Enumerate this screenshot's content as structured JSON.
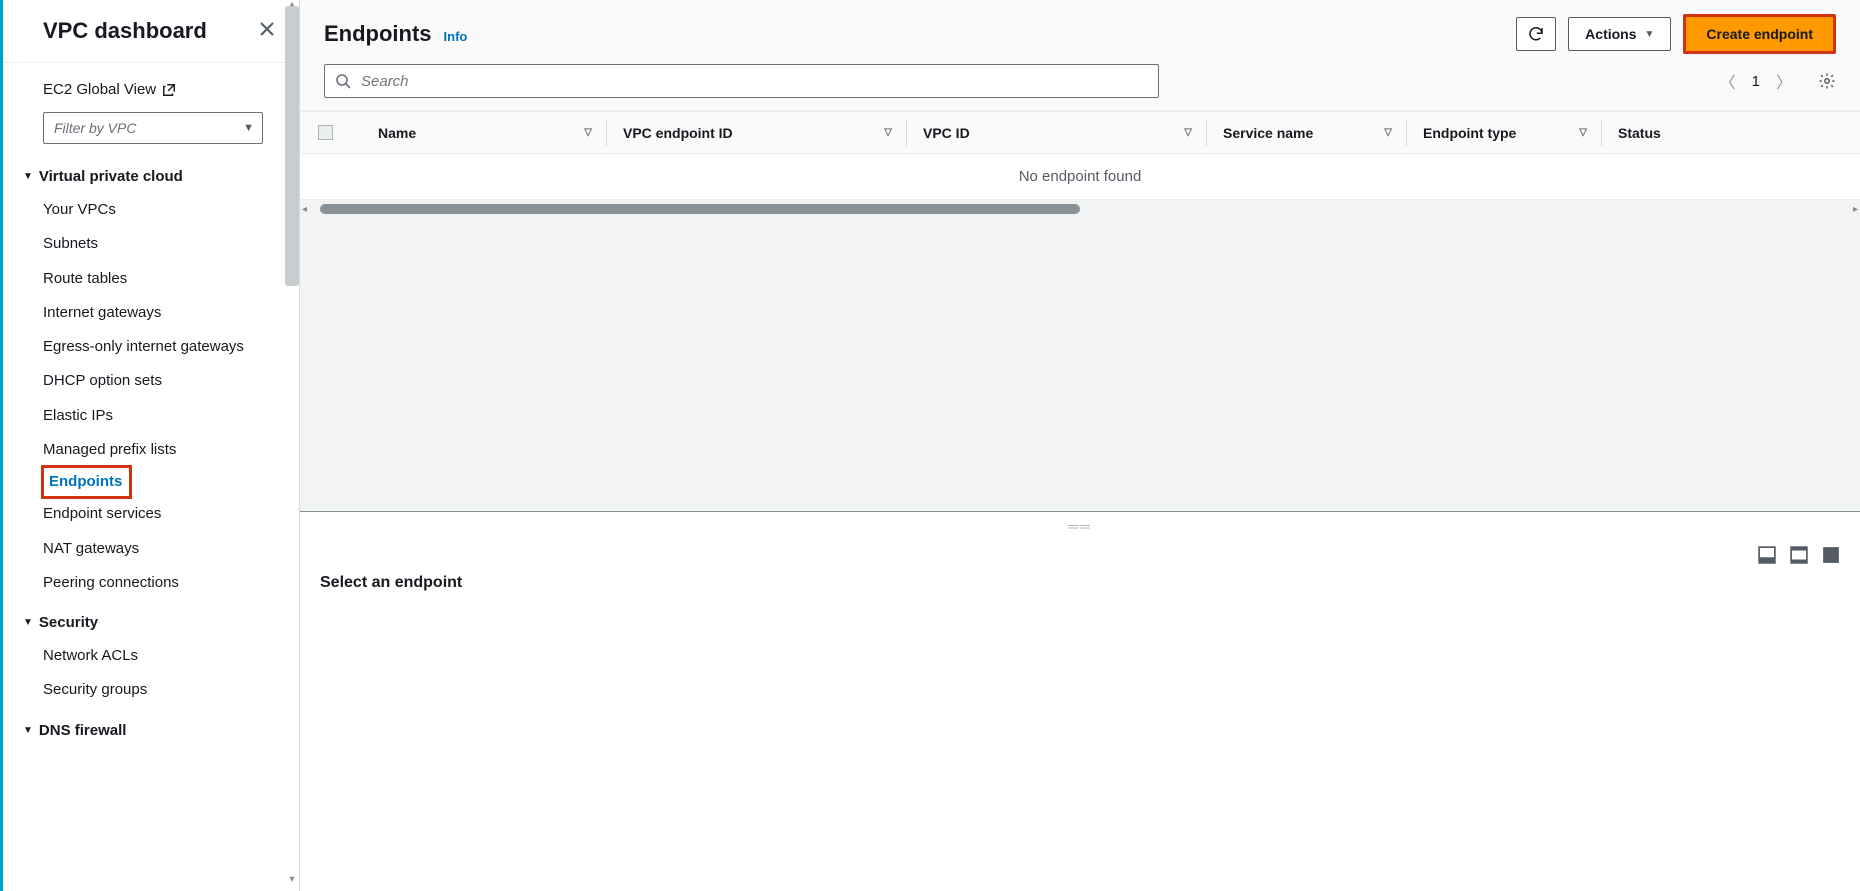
{
  "sidebar": {
    "title": "VPC dashboard",
    "ec2_link": "EC2 Global View",
    "filter_placeholder": "Filter by VPC",
    "groups": [
      {
        "label": "Virtual private cloud",
        "items": [
          {
            "label": "Your VPCs"
          },
          {
            "label": "Subnets"
          },
          {
            "label": "Route tables"
          },
          {
            "label": "Internet gateways"
          },
          {
            "label": "Egress-only internet gateways"
          },
          {
            "label": "DHCP option sets"
          },
          {
            "label": "Elastic IPs"
          },
          {
            "label": "Managed prefix lists"
          },
          {
            "label": "Endpoints",
            "active": true
          },
          {
            "label": "Endpoint services"
          },
          {
            "label": "NAT gateways"
          },
          {
            "label": "Peering connections"
          }
        ]
      },
      {
        "label": "Security",
        "items": [
          {
            "label": "Network ACLs"
          },
          {
            "label": "Security groups"
          }
        ]
      },
      {
        "label": "DNS firewall",
        "items": []
      }
    ]
  },
  "header": {
    "title": "Endpoints",
    "info": "Info",
    "actions_label": "Actions",
    "create_label": "Create endpoint"
  },
  "search": {
    "placeholder": "Search"
  },
  "pagination": {
    "page": "1"
  },
  "columns": {
    "name": "Name",
    "endpoint_id": "VPC endpoint ID",
    "vpc_id": "VPC ID",
    "service_name": "Service name",
    "endpoint_type": "Endpoint type",
    "status": "Status"
  },
  "table": {
    "empty": "No endpoint found"
  },
  "detail": {
    "title": "Select an endpoint"
  }
}
